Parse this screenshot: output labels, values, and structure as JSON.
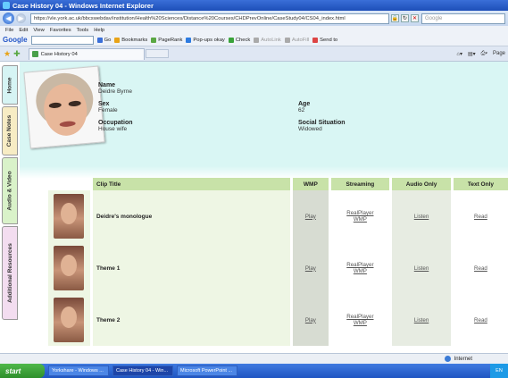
{
  "window": {
    "title": "Case History 04 - Windows Internet Explorer"
  },
  "browser": {
    "address": "https://vle.york.ac.uk/bbcswebdav/institution/Health%20Sciences/Distance%20Courses/CHDPrevOnline/CaseStudy04/CS04_index.html",
    "search_placeholder": "Google",
    "menu": [
      "File",
      "Edit",
      "View",
      "Favorites",
      "Tools",
      "Help"
    ],
    "google_toolbar": [
      "Go",
      "Bookmarks",
      "PageRank",
      "Pop-ups okay",
      "Check",
      "AutoLink",
      "AutoFill",
      "Send to"
    ],
    "google_logo": "Google",
    "tab_title": "Case History 04",
    "tab_right": [
      "Page"
    ]
  },
  "sidebar": {
    "tabs": [
      "Home",
      "Case Notes",
      "Audio & Video",
      "Additional Resources"
    ]
  },
  "patient": {
    "name_label": "Name",
    "name": "Deidre Byrne",
    "sex_label": "Sex",
    "sex": "Female",
    "age_label": "Age",
    "age": "62",
    "occupation_label": "Occupation",
    "occupation": "House wife",
    "social_label": "Social Situation",
    "social": "Widowed"
  },
  "clips": {
    "headers": [
      "Clip Title",
      "WMP",
      "Streaming",
      "Audio Only",
      "Text Only"
    ],
    "rows": [
      {
        "title": "Deidre's monologue",
        "wmp": "Play",
        "stream1": "RealPlayer",
        "stream2": "WMP",
        "audio": "Listen",
        "text": "Read"
      },
      {
        "title": "Theme 1",
        "wmp": "Play",
        "stream1": "RealPlayer",
        "stream2": "WMP",
        "audio": "Listen",
        "text": "Read"
      },
      {
        "title": "Theme 2",
        "wmp": "Play",
        "stream1": "RealPlayer",
        "stream2": "WMP",
        "audio": "Listen",
        "text": "Read"
      }
    ]
  },
  "status": {
    "zone": "Internet"
  },
  "taskbar": {
    "start": "start",
    "tasks": [
      "Yorkshare - Windows ...",
      "Case History 04 - Win...",
      "Microsoft PowerPoint ..."
    ],
    "tray": "EN"
  }
}
